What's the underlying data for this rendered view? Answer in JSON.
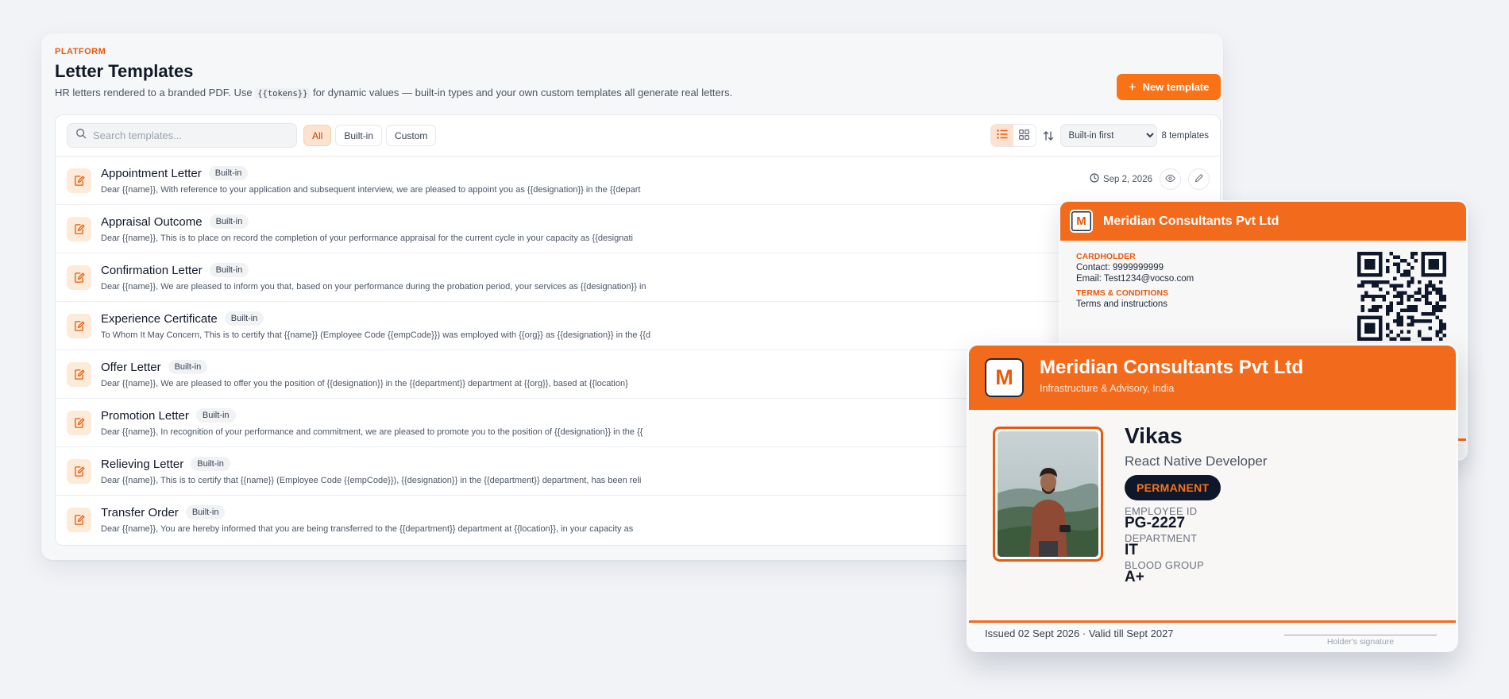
{
  "header": {
    "eyebrow": "PLATFORM",
    "title": "Letter Templates",
    "subtitle_before": "HR letters rendered to a branded PDF. Use ",
    "subtitle_code": "{{tokens}}",
    "subtitle_after": " for dynamic values — built-in types and your own custom templates all generate real letters.",
    "new_button": "New template"
  },
  "toolbar": {
    "search_placeholder": "Search templates...",
    "filters": [
      "All",
      "Built-in",
      "Custom"
    ],
    "active_filter": "All",
    "sort_options": [
      "Built-in first"
    ],
    "sort_selected": "Built-in first",
    "count": "8 templates"
  },
  "templates": [
    {
      "name": "Appointment Letter",
      "badge": "Built-in",
      "desc": "Dear {{name}}, With reference to your application and subsequent interview, we are pleased to appoint you as {{designation}} in the {{depart",
      "date": "Sep 2, 2026"
    },
    {
      "name": "Appraisal Outcome",
      "badge": "Built-in",
      "desc": "Dear {{name}}, This is to place on record the completion of your performance appraisal for the current cycle in your capacity as {{designati"
    },
    {
      "name": "Confirmation Letter",
      "badge": "Built-in",
      "desc": "Dear {{name}}, We are pleased to inform you that, based on your performance during the probation period, your services as {{designation}} in"
    },
    {
      "name": "Experience Certificate",
      "badge": "Built-in",
      "desc": "To Whom It May Concern, This is to certify that {{name}} (Employee Code {{empCode}}) was employed with {{org}} as {{designation}} in the {{d"
    },
    {
      "name": "Offer Letter",
      "badge": "Built-in",
      "desc": "Dear {{name}}, We are pleased to offer you the position of {{designation}} in the {{department}} department at {{org}}, based at {{location}"
    },
    {
      "name": "Promotion Letter",
      "badge": "Built-in",
      "desc": "Dear {{name}}, In recognition of your performance and commitment, we are pleased to promote you to the position of {{designation}} in the {{"
    },
    {
      "name": "Relieving Letter",
      "badge": "Built-in",
      "desc": "Dear {{name}}, This is to certify that {{name}} (Employee Code {{empCode}}), {{designation}} in the {{department}} department, has been reli"
    },
    {
      "name": "Transfer Order",
      "badge": "Built-in",
      "desc": "Dear {{name}}, You are hereby informed that you are being transferred to the {{department}} department at {{location}}, in your capacity as"
    }
  ],
  "id_back": {
    "logo_letter": "M",
    "org": "Meridian Consultants Pvt Ltd",
    "cardholder_label": "CARDHOLDER",
    "contact": "Contact: 9999999999",
    "email": "Email: Test1234@vocso.com",
    "terms_label": "TERMS & CONDITIONS",
    "terms_text": "Terms and instructions",
    "qr_icon": "qr-code-icon"
  },
  "id_front": {
    "logo_letter": "M",
    "org": "Meridian Consultants Pvt Ltd",
    "tagline": "Infrastructure & Advisory, India",
    "name": "Vikas",
    "role": "React Native Developer",
    "status": "PERMANENT",
    "fields": [
      {
        "label": "EMPLOYEE ID",
        "value": "PG-2227"
      },
      {
        "label": "DEPARTMENT",
        "value": "IT"
      },
      {
        "label": "BLOOD GROUP",
        "value": "A+"
      }
    ],
    "validity": "Issued 02 Sept 2026  ·  Valid till Sept 2027",
    "signature_label": "Holder's signature"
  },
  "colors": {
    "accent": "#f97316",
    "card_brand": "#f26b1d",
    "status_pill": "#0f172a"
  }
}
